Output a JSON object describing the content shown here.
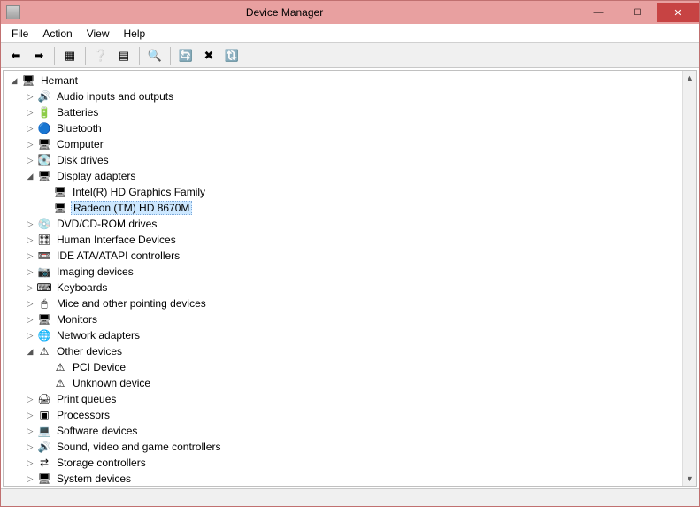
{
  "title": "Device Manager",
  "menus": {
    "file": "File",
    "action": "Action",
    "view": "View",
    "help": "Help"
  },
  "root": "Hemant",
  "tree": [
    {
      "label": "Audio inputs and outputs",
      "icon": "🔊",
      "exp": "▷"
    },
    {
      "label": "Batteries",
      "icon": "🔋",
      "exp": "▷"
    },
    {
      "label": "Bluetooth",
      "icon": "🔵",
      "exp": "▷"
    },
    {
      "label": "Computer",
      "icon": "🖥",
      "exp": "▷"
    },
    {
      "label": "Disk drives",
      "icon": "💽",
      "exp": "▷"
    },
    {
      "label": "Display adapters",
      "icon": "🖥",
      "exp": "◢",
      "children": [
        {
          "label": "Intel(R) HD Graphics Family",
          "icon": "🖥"
        },
        {
          "label": "Radeon (TM) HD 8670M",
          "icon": "🖥",
          "selected": true
        }
      ]
    },
    {
      "label": "DVD/CD-ROM drives",
      "icon": "💿",
      "exp": "▷"
    },
    {
      "label": "Human Interface Devices",
      "icon": "🎛",
      "exp": "▷"
    },
    {
      "label": "IDE ATA/ATAPI controllers",
      "icon": "📼",
      "exp": "▷"
    },
    {
      "label": "Imaging devices",
      "icon": "📷",
      "exp": "▷"
    },
    {
      "label": "Keyboards",
      "icon": "⌨",
      "exp": "▷"
    },
    {
      "label": "Mice and other pointing devices",
      "icon": "🖱",
      "exp": "▷"
    },
    {
      "label": "Monitors",
      "icon": "🖥",
      "exp": "▷"
    },
    {
      "label": "Network adapters",
      "icon": "🌐",
      "exp": "▷"
    },
    {
      "label": "Other devices",
      "icon": "⚠",
      "exp": "◢",
      "children": [
        {
          "label": "PCI Device",
          "icon": "⚠"
        },
        {
          "label": "Unknown device",
          "icon": "⚠"
        }
      ]
    },
    {
      "label": "Print queues",
      "icon": "🖨",
      "exp": "▷"
    },
    {
      "label": "Processors",
      "icon": "▣",
      "exp": "▷"
    },
    {
      "label": "Software devices",
      "icon": "💻",
      "exp": "▷"
    },
    {
      "label": "Sound, video and game controllers",
      "icon": "🔊",
      "exp": "▷"
    },
    {
      "label": "Storage controllers",
      "icon": "⇄",
      "exp": "▷"
    },
    {
      "label": "System devices",
      "icon": "🖥",
      "exp": "▷"
    }
  ]
}
